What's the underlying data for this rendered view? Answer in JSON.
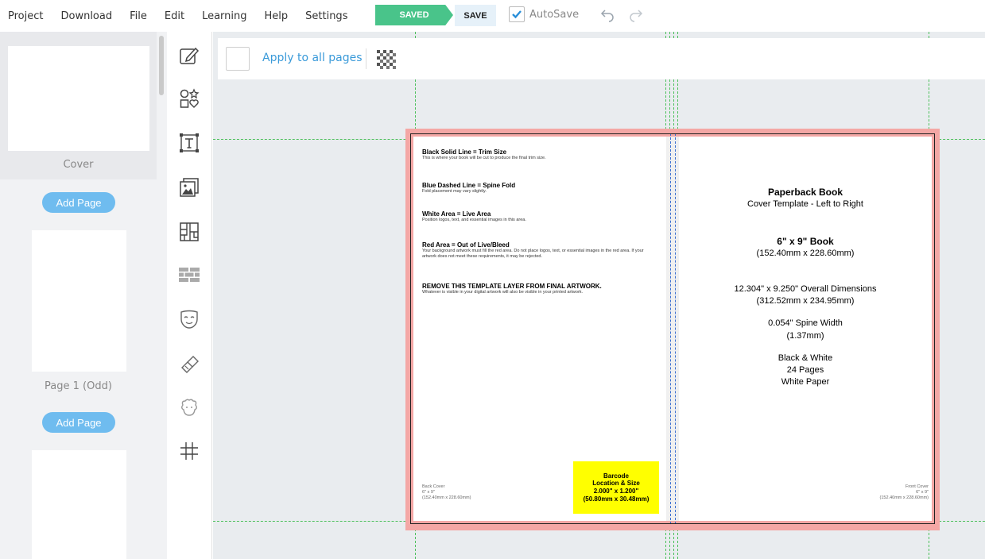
{
  "menu": {
    "items": [
      "Project",
      "Download",
      "File",
      "Edit",
      "Learning",
      "Help",
      "Settings"
    ]
  },
  "toolbar": {
    "saved_label": "SAVED",
    "save_label": "SAVE",
    "autosave_label": "AutoSave",
    "autosave_checked": true
  },
  "pages": {
    "cover_label": "Cover",
    "add_page_label": "Add Page",
    "page1_label": "Page 1 (Odd)"
  },
  "apply_bar": {
    "label": "Apply to all pages"
  },
  "template": {
    "back": {
      "h1": "Black Solid Line = Trim Size",
      "p1": "This is where your book will be cut to produce the final trim size.",
      "h2": "Blue Dashed Line = Spine Fold",
      "p2": "Fold placement may vary slightly.",
      "h3": "White Area = Live Area",
      "p3": "Position logos, text, and essential images in this area.",
      "h4": "Red Area = Out of Live/Bleed",
      "p4": "Your background artwork must fill the red area. Do not place logos, text, or essential images in the red area. If your artwork does not meet these requirements, it may be rejected.",
      "h5": "REMOVE THIS TEMPLATE LAYER FROM FINAL ARTWORK.",
      "p5": "Whatever is visible in your digital artwork will also be visible in your printed artwork.",
      "label_title": "Back Cover",
      "label_size": "6\" x 9\"",
      "label_mm": "(152.40mm x 228.60mm)"
    },
    "barcode": {
      "line1": "Barcode",
      "line2": "Location & Size",
      "line3": "2.000\" x 1.200\"",
      "line4": "(50.80mm x 30.48mm)"
    },
    "front": {
      "title": "Paperback Book",
      "subtitle": "Cover Template - Left to Right",
      "size": "6\" x 9\" Book",
      "size_mm": "(152.40mm x 228.60mm)",
      "overall": "12.304\" x 9.250\" Overall Dimensions",
      "overall_mm": "(312.52mm x 234.95mm)",
      "spine": "0.054\" Spine Width",
      "spine_mm": "(1.37mm)",
      "color": "Black & White",
      "pages": "24 Pages",
      "paper": "White Paper",
      "label_title": "Front Cover",
      "label_size": "6\" x 9\"",
      "label_mm": "(152.40mm x 228.60mm)"
    }
  },
  "colors": {
    "saved": "#49c48a",
    "accent": "#3a9ad9",
    "add_page": "#6fbcef",
    "bleed": "#f4a7a5",
    "guide": "#4cc05b",
    "barcode": "#ffff00"
  },
  "icons": [
    "edit-icon",
    "shapes-icon",
    "text-icon",
    "image-icon",
    "layout-icon",
    "pattern-icon",
    "mask-icon",
    "brush-icon",
    "sheep-icon",
    "grid-icon"
  ]
}
